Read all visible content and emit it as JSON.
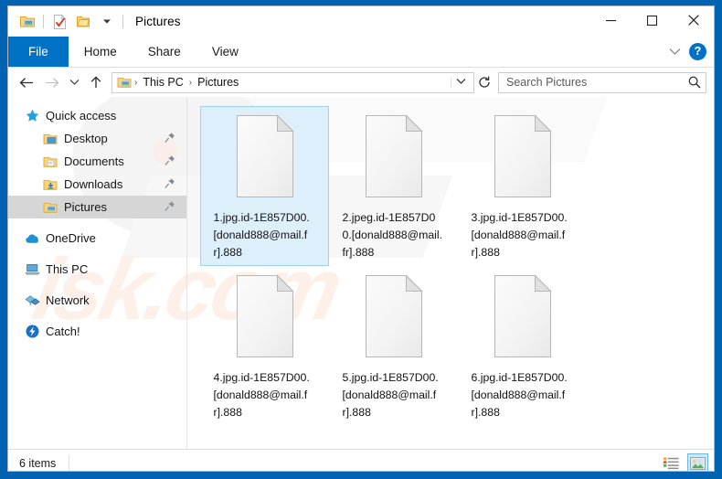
{
  "window": {
    "title": "Pictures",
    "quick_access_toolbar": [
      {
        "icon": "pictures-folder-icon",
        "name": "qat-pictures"
      },
      {
        "icon": "properties-icon",
        "name": "qat-properties"
      },
      {
        "icon": "new-folder-icon",
        "name": "qat-new-folder"
      },
      {
        "icon": "chevron-down-icon",
        "name": "qat-customize"
      }
    ],
    "controls": {
      "minimize": "—",
      "maximize": "☐",
      "close": "✕"
    },
    "frame_color": "#0063b1"
  },
  "ribbon": {
    "tabs": [
      {
        "label": "File",
        "active": true
      },
      {
        "label": "Home",
        "active": false
      },
      {
        "label": "Share",
        "active": false
      },
      {
        "label": "View",
        "active": false
      }
    ],
    "expand_icon": "chevron-down-icon",
    "help_label": "?"
  },
  "address_bar": {
    "back": "←",
    "forward": "→",
    "recent": "⌄",
    "up": "↑",
    "breadcrumb": [
      "This PC",
      "Pictures"
    ],
    "separator": "›",
    "dropdown": "⌄",
    "refresh": "↻"
  },
  "search": {
    "placeholder": "Search Pictures",
    "value": "",
    "icon": "search-icon"
  },
  "sidebar": {
    "items": [
      {
        "label": "Quick access",
        "icon": "star-icon",
        "level": 0,
        "pinned": false,
        "selected": false
      },
      {
        "label": "Desktop",
        "icon": "desktop-folder-icon",
        "level": 1,
        "pinned": true,
        "selected": false
      },
      {
        "label": "Documents",
        "icon": "documents-folder-icon",
        "level": 1,
        "pinned": true,
        "selected": false
      },
      {
        "label": "Downloads",
        "icon": "downloads-folder-icon",
        "level": 1,
        "pinned": true,
        "selected": false
      },
      {
        "label": "Pictures",
        "icon": "pictures-folder-icon",
        "level": 1,
        "pinned": true,
        "selected": true
      },
      {
        "label": "OneDrive",
        "icon": "cloud-icon",
        "level": 0,
        "pinned": false,
        "selected": false
      },
      {
        "label": "This PC",
        "icon": "monitor-icon",
        "level": 0,
        "pinned": false,
        "selected": false
      },
      {
        "label": "Network",
        "icon": "network-icon",
        "level": 0,
        "pinned": false,
        "selected": false
      },
      {
        "label": "Catch!",
        "icon": "catch-icon",
        "level": 0,
        "pinned": false,
        "selected": false
      }
    ]
  },
  "files": [
    {
      "name": "1.jpg.id-1E857D00.[donald888@mail.fr].888",
      "icon": "blank-file-icon",
      "selected": true
    },
    {
      "name": "2.jpeg.id-1E857D00.[donald888@mail.fr].888",
      "icon": "blank-file-icon",
      "selected": false
    },
    {
      "name": "3.jpg.id-1E857D00.[donald888@mail.fr].888",
      "icon": "blank-file-icon",
      "selected": false
    },
    {
      "name": "4.jpg.id-1E857D00.[donald888@mail.fr].888",
      "icon": "blank-file-icon",
      "selected": false
    },
    {
      "name": "5.jpg.id-1E857D00.[donald888@mail.fr].888",
      "icon": "blank-file-icon",
      "selected": false
    },
    {
      "name": "6.jpg.id-1E857D00.[donald888@mail.fr].888",
      "icon": "blank-file-icon",
      "selected": false
    }
  ],
  "status_bar": {
    "item_count": "6 items",
    "views": [
      {
        "name": "details-view-button",
        "icon": "details-list-icon",
        "active": false
      },
      {
        "name": "large-icons-view-button",
        "icon": "thumbnail-icon",
        "active": true
      }
    ]
  },
  "watermark": {
    "text": "isk.com"
  }
}
